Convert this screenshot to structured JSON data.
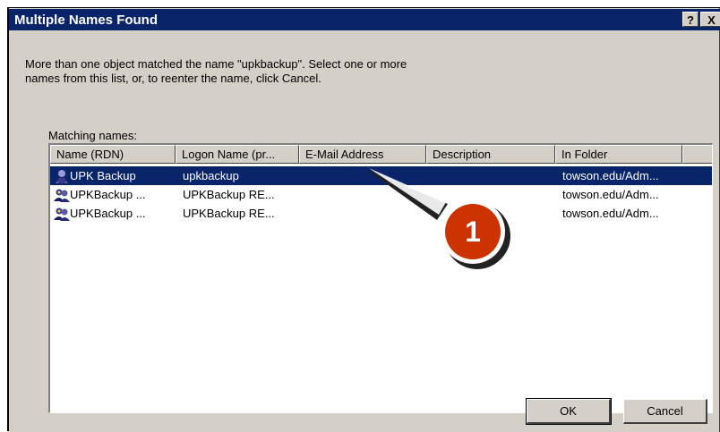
{
  "window": {
    "title": "Multiple Names Found",
    "help_label": "?",
    "close_label": "X"
  },
  "message": {
    "line1": "More than one object matched the name \"upkbackup\".  Select one or more",
    "line2": "names from this list, or, to reenter the name, click Cancel."
  },
  "matching_label": "Matching names:",
  "columns": [
    "Name (RDN)",
    "Logon Name (pr...",
    "E-Mail Address",
    "Description",
    "In Folder"
  ],
  "rows": [
    {
      "name": "UPK Backup",
      "logon": "upkbackup",
      "email": "",
      "description": "",
      "folder": "towson.edu/Adm...",
      "icon": "user-icon",
      "selected": true
    },
    {
      "name": "UPKBackup ...",
      "logon": "UPKBackup RE...",
      "email": "",
      "description": "",
      "folder": "towson.edu/Adm...",
      "icon": "group-icon",
      "selected": false
    },
    {
      "name": "UPKBackup ...",
      "logon": "UPKBackup RE...",
      "email": "",
      "description": "",
      "folder": "towson.edu/Adm...",
      "icon": "group-icon",
      "selected": false
    }
  ],
  "buttons": {
    "ok": "OK",
    "cancel": "Cancel"
  },
  "callout": {
    "number": "1"
  },
  "colors": {
    "titlebar": "#0a246a",
    "face": "#d4d0c8",
    "selection": "#0a246a",
    "callout": "#cc3300"
  }
}
